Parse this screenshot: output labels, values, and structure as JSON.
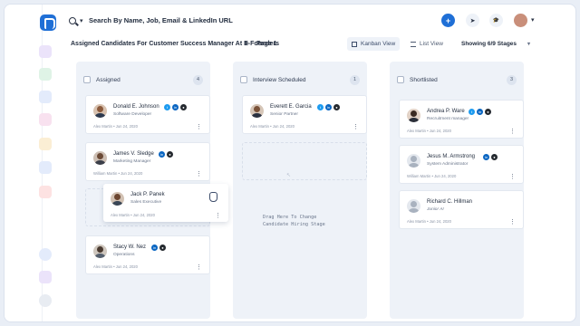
{
  "topbar": {
    "search_label": "Search By Name, Job, Email & LinkedIn URL",
    "add_icon": "+",
    "send_icon": "➤",
    "hat_icon": "🎓"
  },
  "breadcrumb": {
    "title": "Assigned Candidates For Customer Success Manager At E-Founders",
    "separator": ">",
    "page": "Page 1"
  },
  "views": {
    "kanban": "Kanban View",
    "list": "List View"
  },
  "stages_filter": "Showing 6/9 Stages",
  "columns": [
    {
      "title": "Assigned",
      "count": "4",
      "cards": [
        {
          "name": "Donald E. Johnson",
          "role": "Software Developer",
          "meta": "Alex Martin  • Jun 24, 2020"
        },
        {
          "name": "James V. Sledge",
          "role": "Marketing Manager",
          "meta": "William Martin  • Jun 24, 2020"
        },
        {
          "name": "Stacy W. Nez",
          "role": "Operations",
          "meta": "Alex Martin  • Jun 24, 2020"
        }
      ]
    },
    {
      "title": "Interview Scheduled",
      "count": "1",
      "cards": [
        {
          "name": "Everett E. Garcia",
          "role": "Senior Partner",
          "meta": "Alex Martin  • Jun 24, 2020"
        }
      ]
    },
    {
      "title": "Shortlisted",
      "count": "3",
      "cards": [
        {
          "name": "Andrea P. Ware",
          "role": "Recruitment manager",
          "meta": "Alex Martin  • Jun 24, 2020"
        },
        {
          "name": "Jesus M. Armstrong",
          "role": "System Administrator",
          "meta": "William Martin  • Jun 24, 2020"
        },
        {
          "name": "Richard C. Hillman",
          "role": "Junior AI",
          "meta": "Alex Martin  • Jun 24, 2020"
        }
      ]
    }
  ],
  "dragging": {
    "name": "Jack P. Panek",
    "role": "Sales Executive",
    "meta": "Alex Martin  • Jun 24, 2020"
  },
  "drop_hint": "Drag Here To Change\nCandidate Hiring Stage",
  "menu_glyph": "⋮",
  "colors": {
    "brand": "#1f6fd6",
    "twitter": "#1d9bf0",
    "linkedin": "#0a66c2",
    "github": "#24292f"
  }
}
